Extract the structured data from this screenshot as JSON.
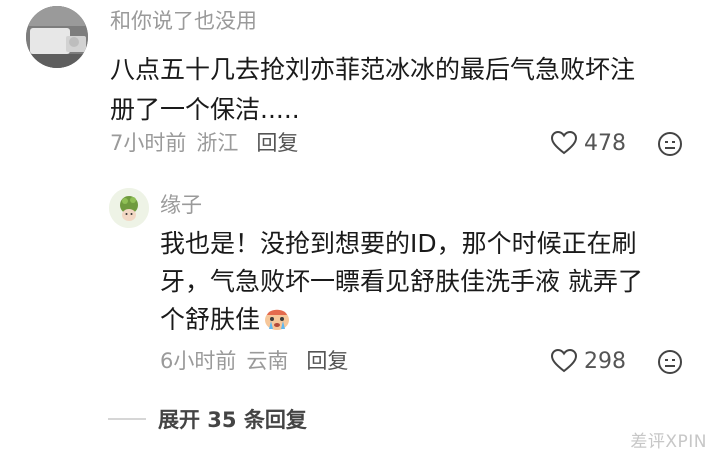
{
  "comment": {
    "username": "和你说了也没用",
    "text_line1": "八点五十几去抢刘亦菲范冰冰的最后气急败坏注",
    "text_line2": "册了一个保洁.....",
    "time": "7小时前",
    "location": "浙江",
    "reply_label": "回复",
    "like_count": "478"
  },
  "reply": {
    "username": "缘子",
    "text_line1": "我也是！没抢到想要的ID，那个时候正在刷",
    "text_line2": "牙，气急败坏一瞟看见舒肤佳洗手液 就弄了",
    "text_line3": "个舒肤佳",
    "time": "6小时前",
    "location": "云南",
    "reply_label": "回复",
    "like_count": "298"
  },
  "expand_label": "展开 35 条回复",
  "watermark": "差评XPIN",
  "icons": {
    "like": "heart-outline-icon",
    "dislike": "sad-face-icon",
    "emoji": "crying-face-emoji"
  }
}
